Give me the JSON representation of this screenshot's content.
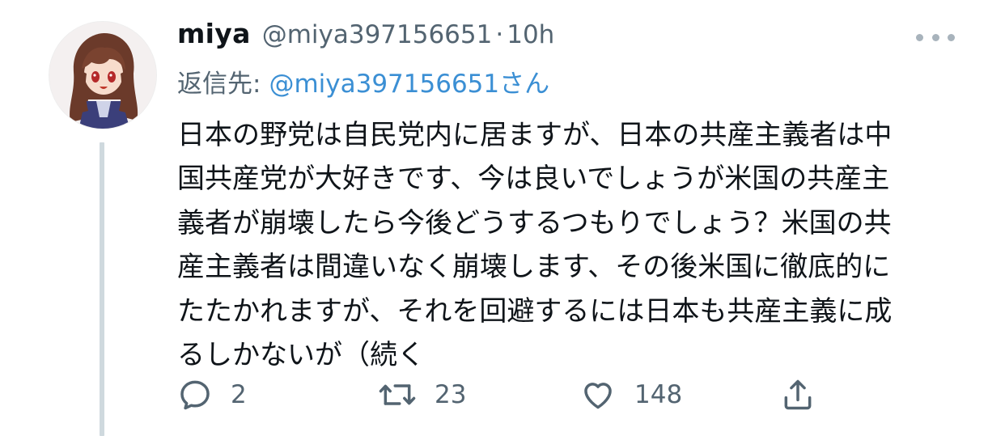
{
  "tweet": {
    "display_name": "miya",
    "handle": "@miya397156651",
    "separator": "·",
    "time": "10h",
    "reply_label": "返信先:",
    "reply_to": "@miya397156651さん",
    "body_lines": [
      "日本の野党は自民党内に居ますが、日本の共産主義者は中",
      "国共産党が大好きです、今は良いでしょうが米国の共産主",
      "義者が崩壊したら今後どうするつもりでしょう？米国の共",
      "産主義者は間違いなく崩壊します、その後米国に徹底的に",
      "たたかれますが、それを回避するには日本も共産主義に成",
      "るしかないが（続く"
    ]
  },
  "actions": {
    "reply_count": "2",
    "retweet_count": "23",
    "like_count": "148"
  },
  "icons": {
    "avatar": "avatar-image",
    "more": "more-options-icon",
    "reply": "reply-icon",
    "retweet": "retweet-icon",
    "like": "like-icon",
    "share": "share-icon"
  },
  "colors": {
    "text": "#0f1419",
    "secondary": "#536471",
    "link": "#3b8fd4",
    "thread_line": "#cfd9de"
  }
}
